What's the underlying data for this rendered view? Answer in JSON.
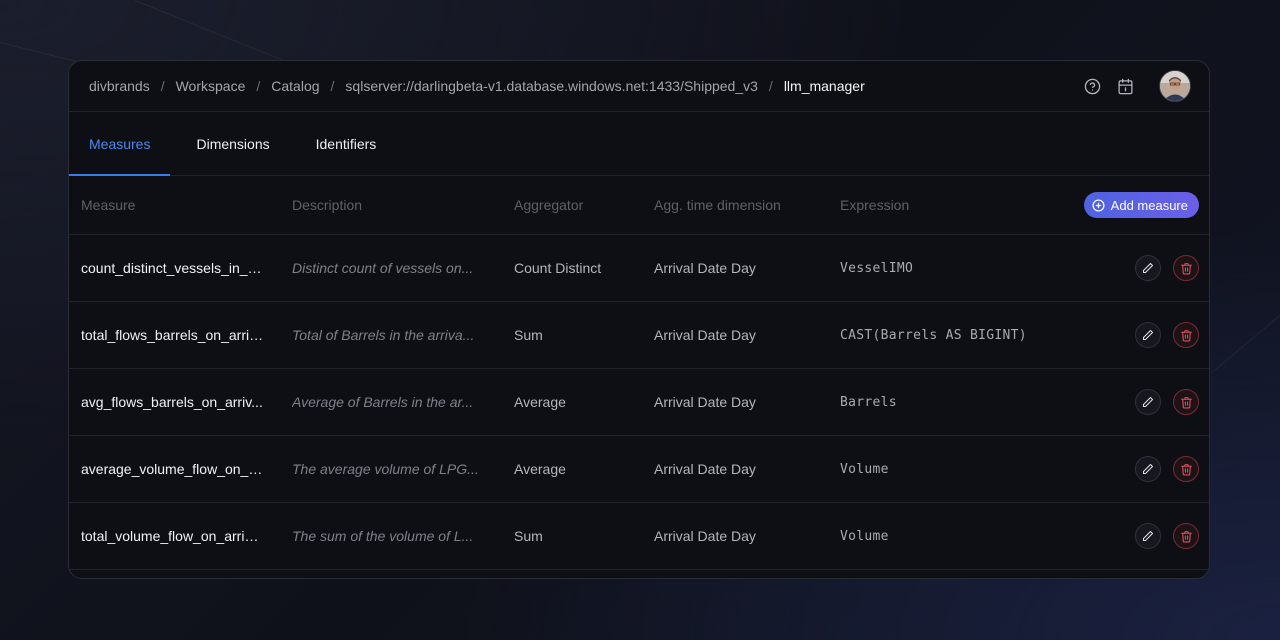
{
  "breadcrumb": {
    "items": [
      "divbrands",
      "Workspace",
      "Catalog",
      "sqlserver://darlingbeta-v1.database.windows.net:1433/Shipped_v3"
    ],
    "current": "llm_manager",
    "separator": "/"
  },
  "topbar": {
    "icons": [
      "help-circle-icon",
      "calendar-icon"
    ],
    "avatar": "user-avatar"
  },
  "tabs": [
    {
      "label": "Measures",
      "active": true
    },
    {
      "label": "Dimensions",
      "active": false
    },
    {
      "label": "Identifiers",
      "active": false
    }
  ],
  "table": {
    "headers": {
      "measure": "Measure",
      "description": "Description",
      "aggregator": "Aggregator",
      "time_dimension": "Agg. time dimension",
      "expression": "Expression"
    },
    "add_button_label": "Add measure",
    "rows": [
      {
        "measure": "count_distinct_vessels_in_fl...",
        "description": "Distinct count of vessels on...",
        "aggregator": "Count Distinct",
        "time_dimension": "Arrival Date Day",
        "expression": "VesselIMO"
      },
      {
        "measure": "total_flows_barrels_on_arriv...",
        "description": "Total of Barrels in the arriva...",
        "aggregator": "Sum",
        "time_dimension": "Arrival Date Day",
        "expression": "CAST(Barrels AS BIGINT)"
      },
      {
        "measure": "avg_flows_barrels_on_arriv...",
        "description": "Average of Barrels in the ar...",
        "aggregator": "Average",
        "time_dimension": "Arrival Date Day",
        "expression": "Barrels"
      },
      {
        "measure": "average_volume_flow_on_ar...",
        "description": "The average volume of LPG...",
        "aggregator": "Average",
        "time_dimension": "Arrival Date Day",
        "expression": "Volume"
      },
      {
        "measure": "total_volume_flow_on_arriva...",
        "description": "The sum of the volume of L...",
        "aggregator": "Sum",
        "time_dimension": "Arrival Date Day",
        "expression": "Volume"
      }
    ]
  },
  "colors": {
    "accent": "#4b8af0",
    "add_button": "#5b61e3",
    "delete": "#e0505e",
    "panel_bg": "#0e0f15"
  }
}
